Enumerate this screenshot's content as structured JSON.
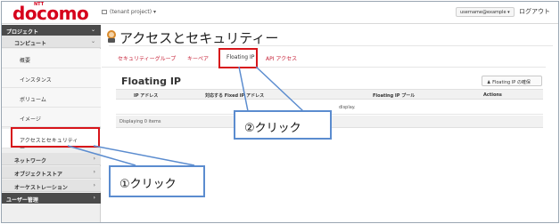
{
  "header": {
    "logo": "docomo",
    "logo_superscript": "NTT",
    "project_switch": "(tenant project) ▾",
    "user_menu": "username@example ▾",
    "logout": "ログアウト"
  },
  "sidebar": {
    "project_label": "プロジェクト",
    "compute_label": "コンピュート",
    "items": [
      {
        "label": "概要"
      },
      {
        "label": "インスタンス"
      },
      {
        "label": "ボリューム"
      },
      {
        "label": "イメージ"
      },
      {
        "label": "アクセスとセキュリティー"
      }
    ],
    "categories": [
      {
        "label": "ネットワーク"
      },
      {
        "label": "オブジェクトストア"
      },
      {
        "label": "オーケストレーション"
      }
    ],
    "user_mgmt_label": "ユーザー管理"
  },
  "main": {
    "page_title": "アクセスとセキュリティー",
    "tabs": [
      {
        "label": "セキュリティーグループ"
      },
      {
        "label": "キーペア"
      },
      {
        "label": "Floating IP"
      },
      {
        "label": "API アクセス"
      }
    ],
    "section_title": "Floating IP",
    "allocate_button": "Floating IP の確保",
    "table": {
      "columns": [
        "IP アドレス",
        "対応する Fixed IP アドレス",
        "Floating IP プール",
        "Actions"
      ],
      "empty_message": "display.",
      "footer": "Displaying 0 items"
    }
  },
  "annotations": {
    "callout1": "①クリック",
    "callout2": "②クリック"
  },
  "colors": {
    "brand": "#d6001c",
    "highlight": "#d7141a",
    "callout_border": "#5b8ccf",
    "sidebar_dark": "#4b4b4b"
  },
  "icons": [
    "user-icon",
    "chevron-down-icon",
    "chevron-right-icon",
    "security-mascot-icon",
    "pc-icon"
  ]
}
